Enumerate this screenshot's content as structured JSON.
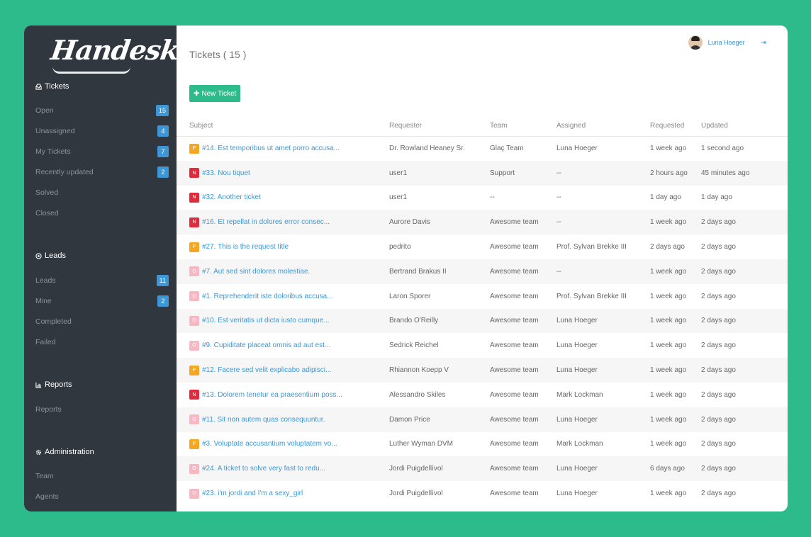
{
  "brand": "Handesk",
  "colors": {
    "accent": "#3d97d6",
    "green": "#2dbb8b",
    "sidebar": "#30373e",
    "P": "#f5a623",
    "N": "#e02b3c",
    "O": "#f7b8c4"
  },
  "sidebar": {
    "tickets": {
      "title": "Tickets",
      "items": [
        {
          "label": "Open",
          "count": "15"
        },
        {
          "label": "Unassigned",
          "count": "4"
        },
        {
          "label": "My Tickets",
          "count": "7"
        },
        {
          "label": "Recently updated",
          "count": "2"
        },
        {
          "label": "Solved",
          "count": ""
        },
        {
          "label": "Closed",
          "count": ""
        }
      ]
    },
    "leads": {
      "title": "Leads",
      "items": [
        {
          "label": "Leads",
          "count": "11"
        },
        {
          "label": "Mine",
          "count": "2"
        },
        {
          "label": "Completed",
          "count": ""
        },
        {
          "label": "Failed",
          "count": ""
        }
      ]
    },
    "reports": {
      "title": "Reports",
      "items": [
        {
          "label": "Reports"
        }
      ]
    },
    "admin": {
      "title": "Administration",
      "items": [
        {
          "label": "Team"
        },
        {
          "label": "Agents"
        }
      ]
    }
  },
  "header": {
    "title": "Tickets ( 15 )",
    "user": "Luna Hoeger"
  },
  "new_ticket": "New Ticket",
  "columns": [
    "Subject",
    "Requester",
    "Team",
    "Assigned",
    "Requested",
    "Updated"
  ],
  "rows": [
    {
      "p": "P",
      "subject": "#14. Est temporibus ut amet porro accusa...",
      "requester": "Dr. Rowland Heaney Sr.",
      "team": "Glaç Team",
      "assigned": "Luna Hoeger",
      "requested": "1 week ago",
      "updated": "1 second ago"
    },
    {
      "p": "N",
      "subject": "#33. Nou tiquet",
      "requester": "user1",
      "team": "Support",
      "assigned": "--",
      "requested": "2 hours ago",
      "updated": "45 minutes ago"
    },
    {
      "p": "N",
      "subject": "#32. Another ticket",
      "requester": "user1",
      "team": "--",
      "assigned": "--",
      "requested": "1 day ago",
      "updated": "1 day ago"
    },
    {
      "p": "N",
      "subject": "#16. Et repellat in dolores error consec...",
      "requester": "Aurore Davis",
      "team": "Awesome team",
      "assigned": "--",
      "requested": "1 week ago",
      "updated": "2 days ago"
    },
    {
      "p": "P",
      "subject": "#27. This is the request title",
      "requester": "pedrito",
      "team": "Awesome team",
      "assigned": "Prof. Sylvan Brekke III",
      "requested": "2 days ago",
      "updated": "2 days ago"
    },
    {
      "p": "O",
      "subject": "#7. Aut sed sint dolores molestiae.",
      "requester": "Bertrand Brakus II",
      "team": "Awesome team",
      "assigned": "--",
      "requested": "1 week ago",
      "updated": "2 days ago"
    },
    {
      "p": "O",
      "subject": "#1. Reprehenderit iste doloribus accusa...",
      "requester": "Laron Sporer",
      "team": "Awesome team",
      "assigned": "Prof. Sylvan Brekke III",
      "requested": "1 week ago",
      "updated": "2 days ago"
    },
    {
      "p": "O",
      "subject": "#10. Est veritatis ut dicta iusto cumque...",
      "requester": "Brando O'Reilly",
      "team": "Awesome team",
      "assigned": "Luna Hoeger",
      "requested": "1 week ago",
      "updated": "2 days ago"
    },
    {
      "p": "O",
      "subject": "#9. Cupiditate placeat omnis ad aut est...",
      "requester": "Sedrick Reichel",
      "team": "Awesome team",
      "assigned": "Luna Hoeger",
      "requested": "1 week ago",
      "updated": "2 days ago"
    },
    {
      "p": "P",
      "subject": "#12. Facere sed velit explicabo adipisci...",
      "requester": "Rhiannon Koepp V",
      "team": "Awesome team",
      "assigned": "Luna Hoeger",
      "requested": "1 week ago",
      "updated": "2 days ago"
    },
    {
      "p": "N",
      "subject": "#13. Dolorem tenetur ea praesentium poss...",
      "requester": "Alessandro Skiles",
      "team": "Awesome team",
      "assigned": "Mark Lockman",
      "requested": "1 week ago",
      "updated": "2 days ago"
    },
    {
      "p": "O",
      "subject": "#11. Sit non autem quas consequuntur.",
      "requester": "Damon Price",
      "team": "Awesome team",
      "assigned": "Luna Hoeger",
      "requested": "1 week ago",
      "updated": "2 days ago"
    },
    {
      "p": "P",
      "subject": "#3. Voluptate accusantium voluptatem vo...",
      "requester": "Luther Wyman DVM",
      "team": "Awesome team",
      "assigned": "Mark Lockman",
      "requested": "1 week ago",
      "updated": "2 days ago"
    },
    {
      "p": "O",
      "subject": "#24. A ticket to solve very fast to redu...",
      "requester": "Jordi Puigdellívol",
      "team": "Awesome team",
      "assigned": "Luna Hoeger",
      "requested": "6 days ago",
      "updated": "2 days ago"
    },
    {
      "p": "O",
      "subject": "#23. i'm jordi and I'm a sexy_girl",
      "requester": "Jordi Puigdellívol",
      "team": "Awesome team",
      "assigned": "Luna Hoeger",
      "requested": "1 week ago",
      "updated": "2 days ago"
    }
  ]
}
